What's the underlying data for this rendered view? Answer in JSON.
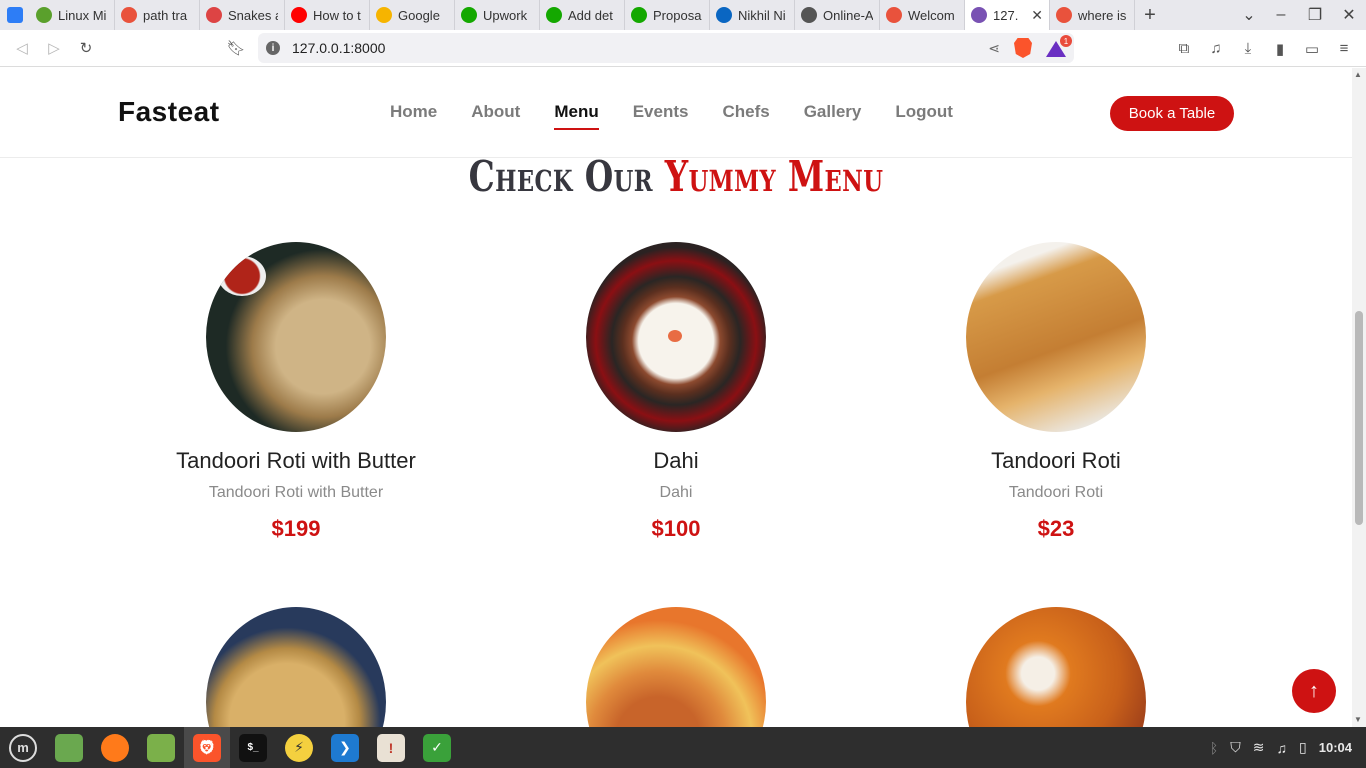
{
  "browser": {
    "tabs": [
      {
        "title": "Linux Mi",
        "favicon": "linux-mint-icon",
        "color": "#5aa02c"
      },
      {
        "title": "path tra",
        "favicon": "brave-search-icon",
        "color": "#e9523c"
      },
      {
        "title": "Snakes a",
        "favicon": "snake-icon",
        "color": "#d44"
      },
      {
        "title": "How to t",
        "favicon": "youtube-icon",
        "color": "#ff0000"
      },
      {
        "title": "Google",
        "favicon": "google-keep-icon",
        "color": "#f6b400"
      },
      {
        "title": "Upwork",
        "favicon": "upwork-icon",
        "color": "#14a800"
      },
      {
        "title": "Add det",
        "favicon": "upwork-icon",
        "color": "#14a800"
      },
      {
        "title": "Proposa",
        "favicon": "upwork-icon",
        "color": "#14a800"
      },
      {
        "title": "Nikhil Ni",
        "favicon": "linkedin-icon",
        "color": "#0a66c2"
      },
      {
        "title": "Online-A",
        "favicon": "globe-icon",
        "color": "#555"
      },
      {
        "title": "Welcom",
        "favicon": "flame-icon",
        "color": "#e9523c"
      },
      {
        "title": "127.",
        "favicon": "bootstrap-icon",
        "color": "#7952b3",
        "active": true
      },
      {
        "title": "where is",
        "favicon": "brave-search-icon",
        "color": "#e9523c"
      }
    ],
    "url": "127.0.0.1:8000",
    "brave_badge": "1"
  },
  "site": {
    "logo": "Fasteat",
    "nav": [
      "Home",
      "About",
      "Menu",
      "Events",
      "Chefs",
      "Gallery",
      "Logout"
    ],
    "active_nav": "Menu",
    "book_button": "Book a Table"
  },
  "menu_section": {
    "title_plain": "Check Our ",
    "title_highlight": "Yummy Menu",
    "items": [
      {
        "name": "Tandoori Roti with Butter",
        "description": "Tandoori Roti with Butter",
        "price": "$199",
        "image": "tandoori-roti-butter-image"
      },
      {
        "name": "Dahi",
        "description": "Dahi",
        "price": "$100",
        "image": "dahi-bowl-image"
      },
      {
        "name": "Tandoori Roti",
        "description": "Tandoori Roti",
        "price": "$23",
        "image": "paratha-stack-image"
      },
      {
        "name": "",
        "description": "",
        "price": "",
        "image": "laddu-image"
      },
      {
        "name": "",
        "description": "",
        "price": "",
        "image": "curry-roti-image"
      },
      {
        "name": "",
        "description": "",
        "price": "",
        "image": "paneer-curry-image"
      }
    ]
  },
  "taskbar": {
    "apps": [
      "mint-menu-icon",
      "show-desktop-icon",
      "firefox-icon",
      "files-icon",
      "brave-icon",
      "terminal-icon",
      "flash-icon",
      "vscode-icon",
      "update-manager-icon",
      "shield-icon"
    ],
    "clock": "10:04"
  },
  "colors": {
    "accent": "#ce1212",
    "taskbar": "#2e2e2e"
  }
}
